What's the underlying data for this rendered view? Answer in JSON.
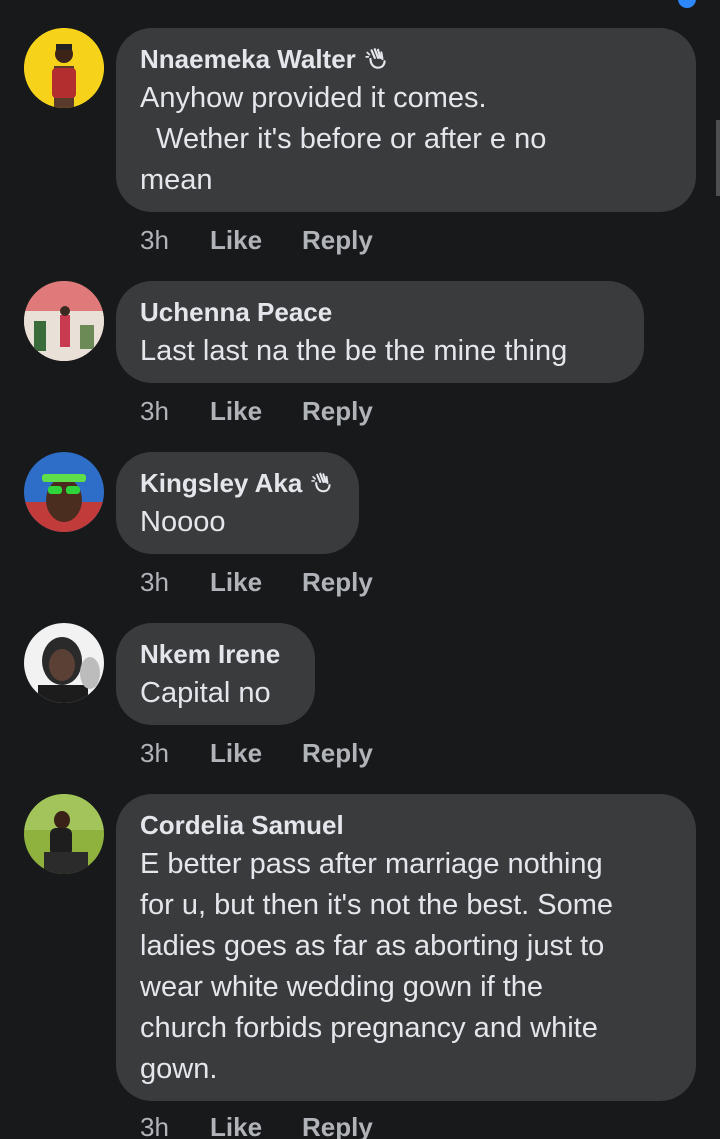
{
  "comments": [
    {
      "author": "Nnaemeka Walter",
      "has_badge": true,
      "badge_icon": "waving-hand-icon",
      "text": "Anyhow provided it comes.\n  Wether it's before or after e no\nmean",
      "time": "3h",
      "like_label": "Like",
      "reply_label": "Reply"
    },
    {
      "author": "Uchenna Peace",
      "has_badge": false,
      "text": "Last last na the be the mine thing",
      "time": "3h",
      "like_label": "Like",
      "reply_label": "Reply"
    },
    {
      "author": "Kingsley Aka",
      "has_badge": true,
      "badge_icon": "waving-hand-icon",
      "text": "Noooo",
      "time": "3h",
      "like_label": "Like",
      "reply_label": "Reply"
    },
    {
      "author": "Nkem Irene",
      "has_badge": false,
      "text": "Capital no",
      "time": "3h",
      "like_label": "Like",
      "reply_label": "Reply"
    },
    {
      "author": "Cordelia Samuel",
      "has_badge": false,
      "text": "E better pass after marriage nothing\nfor u, but then it's not the best. Some\nladies goes as far as aborting just to\nwear white wedding gown if the\nchurch forbids pregnancy and white\ngown.",
      "time": "3h",
      "like_label": "Like",
      "reply_label": "Reply"
    }
  ],
  "colors": {
    "background": "#18191a",
    "bubble": "#3a3b3c",
    "primary_text": "#e4e6eb",
    "secondary_text": "#b0b3b8",
    "accent": "#2d88ff"
  }
}
